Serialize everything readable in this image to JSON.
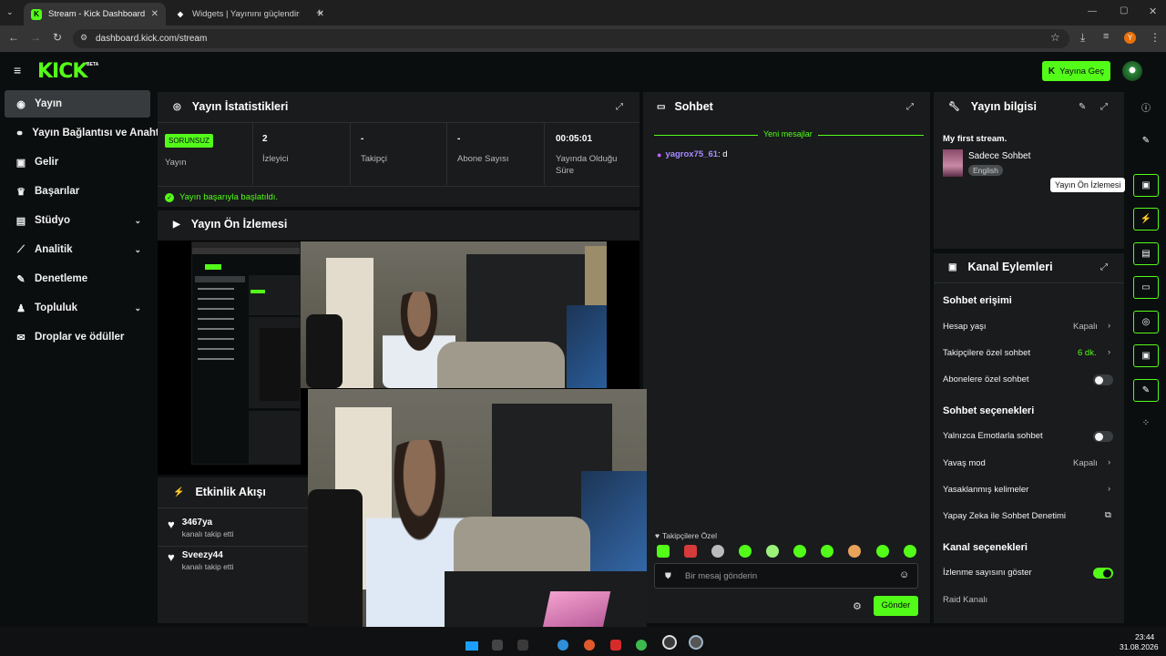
{
  "browser": {
    "tabs": [
      {
        "title": "Stream - Kick Dashboard",
        "active": true
      },
      {
        "title": "Widgets | Yayınını güçlendirme",
        "active": false
      }
    ],
    "url": "dashboard.kick.com/stream",
    "profile_initial": "Y"
  },
  "header": {
    "logo": "KICK",
    "beta": "BETA",
    "go_live_label": "Yayına Geç",
    "accent_color": "#53fc18"
  },
  "sidebar": {
    "items": [
      {
        "label": "Yayın",
        "icon": "broadcast-icon",
        "active": true
      },
      {
        "label": "Yayın Bağlantısı ve Anahtar",
        "icon": "link-icon"
      },
      {
        "label": "Gelir",
        "icon": "revenue-icon"
      },
      {
        "label": "Başarılar",
        "icon": "trophy-icon"
      },
      {
        "label": "Stüdyo",
        "icon": "studio-icon",
        "expandable": true
      },
      {
        "label": "Analitik",
        "icon": "analytics-icon",
        "expandable": true
      },
      {
        "label": "Denetleme",
        "icon": "wrench-icon"
      },
      {
        "label": "Topluluk",
        "icon": "community-icon",
        "expandable": true
      },
      {
        "label": "Droplar ve ödüller",
        "icon": "gift-icon"
      }
    ]
  },
  "stats": {
    "title": "Yayın İstatistikleri",
    "status_badge": "SORUNSUZ",
    "status_label": "Yayın",
    "cells": [
      {
        "value": "2",
        "label": "İzleyici"
      },
      {
        "value": "-",
        "label": "Takipçi"
      },
      {
        "value": "-",
        "label": "Abone Sayısı"
      },
      {
        "value": "00:05:01",
        "label": "Yayında Olduğu Süre"
      }
    ],
    "success_message": "Yayın başarıyla başlatıldı."
  },
  "preview": {
    "title": "Yayın Ön İzlemesi"
  },
  "activity": {
    "title": "Etkinlik Akışı",
    "events": [
      {
        "user": "3467ya",
        "action": "kanalı takip etti"
      },
      {
        "user": "Sveezy44",
        "action": "kanalı takip etti"
      }
    ]
  },
  "chat": {
    "title": "Sohbet",
    "new_messages_label": "Yeni mesajlar",
    "messages": [
      {
        "user": "yagrox75_61",
        "text": "d"
      }
    ],
    "followers_only_label": "Takipçilere Özel",
    "input_placeholder": "Bir mesaj gönderin",
    "send_label": "Gönder"
  },
  "stream_info": {
    "title": "Yayın bilgisi",
    "stream_title": "My first stream.",
    "category": "Sadece Sohbet",
    "language_tag": "English",
    "tooltip": "Yayın Ön İzlemesi"
  },
  "channel_actions": {
    "title": "Kanal Eylemleri",
    "chat_access_header": "Sohbet erişimi",
    "rows_access": [
      {
        "label": "Hesap yaşı",
        "value": "Kapalı",
        "type": "chevron"
      },
      {
        "label": "Takipçilere özel sohbet",
        "value": "6 dk.",
        "type": "chevron",
        "highlight": true
      },
      {
        "label": "Abonelere özel sohbet",
        "type": "toggle",
        "on": false
      }
    ],
    "chat_options_header": "Sohbet seçenekleri",
    "rows_options": [
      {
        "label": "Yalnızca Emotlarla sohbet",
        "type": "toggle",
        "on": false
      },
      {
        "label": "Yavaş mod",
        "value": "Kapalı",
        "type": "chevron"
      },
      {
        "label": "Yasaklanmış kelimeler",
        "type": "chevron"
      },
      {
        "label": "Yapay Zeka ile Sohbet Denetimi",
        "type": "external"
      }
    ],
    "channel_options_header": "Kanal seçenekleri",
    "rows_channel": [
      {
        "label": "İzlenme sayısını göster",
        "type": "toggle",
        "on": true
      }
    ],
    "raid_label": "Raid Kanalı"
  },
  "taskbar": {
    "time": "23:44",
    "date": "31.08.2026"
  }
}
